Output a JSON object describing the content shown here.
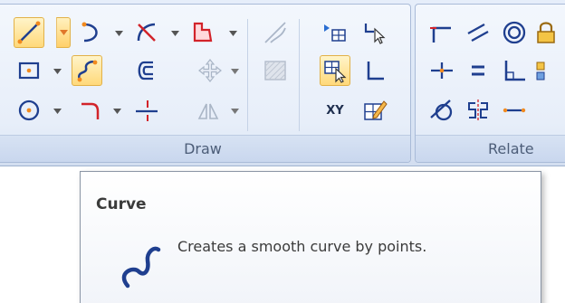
{
  "ribbon": {
    "groups": {
      "draw": {
        "label": "Draw"
      },
      "relate": {
        "label": "Relate"
      }
    },
    "draw_tools": [
      {
        "name": "line-tool",
        "icon": "line-icon",
        "selected": true,
        "has_dropdown": true
      },
      {
        "name": "arc-tool",
        "icon": "arc-icon",
        "has_dropdown": true
      },
      {
        "name": "trim-tool",
        "icon": "trim-icon",
        "has_dropdown": true
      },
      {
        "name": "fill-tool",
        "icon": "fill-icon",
        "has_dropdown": true
      },
      {
        "name": "rectangle-tool",
        "icon": "rectangle-icon",
        "has_dropdown": true
      },
      {
        "name": "curve-tool",
        "icon": "curve-icon",
        "selected": true,
        "has_dropdown": false
      },
      {
        "name": "offset-tool",
        "icon": "offset-icon",
        "has_dropdown": false
      },
      {
        "name": "move-tool",
        "icon": "move-icon",
        "has_dropdown": true,
        "disabled": true
      },
      {
        "name": "circle-tool",
        "icon": "circle-icon",
        "has_dropdown": true
      },
      {
        "name": "fillet-tool",
        "icon": "fillet-icon",
        "has_dropdown": true
      },
      {
        "name": "split-tool",
        "icon": "split-icon",
        "has_dropdown": false
      },
      {
        "name": "mirror-tool",
        "icon": "mirror-icon",
        "has_dropdown": true,
        "disabled": true
      }
    ],
    "xy_label": "XY"
  },
  "tooltip": {
    "title": "Curve",
    "description": "Creates a smooth curve by points."
  },
  "colors": {
    "accent_selected": "#ffd97a",
    "icon_orange": "#f28a1e",
    "icon_blue": "#1f3f8f",
    "icon_red": "#d2232a"
  }
}
